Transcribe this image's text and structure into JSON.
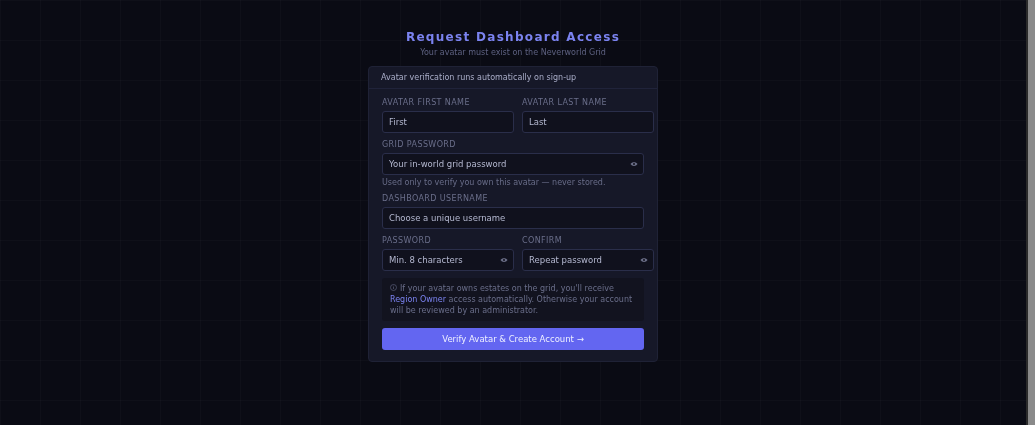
{
  "header": {
    "title": "Request Dashboard Access",
    "subtitle": "Your avatar must exist on the Neverworld Grid"
  },
  "card": {
    "notice": "Avatar verification runs automatically on sign-up",
    "rows": [
      {
        "fields": [
          {
            "label": "AVATAR FIRST NAME",
            "placeholder": "First",
            "reveal": false
          },
          {
            "label": "AVATAR LAST NAME",
            "placeholder": "Last",
            "reveal": false
          }
        ]
      },
      {
        "fields": [
          {
            "label": "GRID PASSWORD",
            "placeholder": "Your in-world grid password",
            "reveal": true
          }
        ],
        "hint": "Used only to verify you own this avatar — never stored."
      },
      {
        "fields": [
          {
            "label": "DASHBOARD USERNAME",
            "placeholder": "Choose a unique username",
            "reveal": false
          }
        ]
      },
      {
        "fields": [
          {
            "label": "PASSWORD",
            "placeholder": "Min. 8 characters",
            "reveal": true
          },
          {
            "label": "CONFIRM",
            "placeholder": "Repeat password",
            "reveal": true
          }
        ]
      }
    ],
    "info": {
      "before": "If your avatar owns estates on the grid, you'll receive",
      "link": "Region Owner",
      "after": "access automatically. Otherwise your account will be reviewed by an administrator."
    },
    "submit": "Verify Avatar & Create Account →"
  }
}
